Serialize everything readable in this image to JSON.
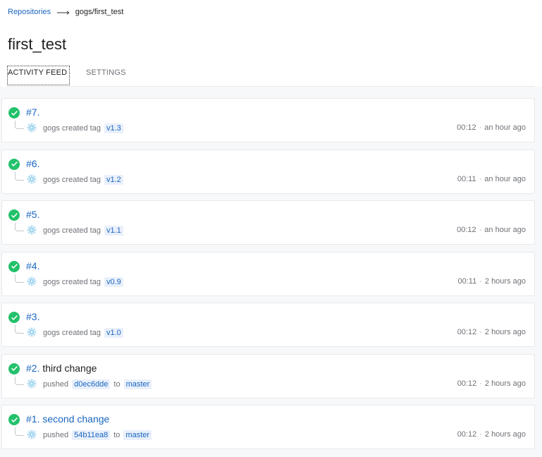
{
  "breadcrumb": {
    "root": "Repositories",
    "current": "gogs/first_test"
  },
  "page_title": "first_test",
  "tabs": [
    {
      "label": "ACTIVITY FEED"
    },
    {
      "label": "SETTINGS"
    }
  ],
  "builds": [
    {
      "number": "#7.",
      "message": "",
      "author": "gogs",
      "action": "created tag",
      "ref": "v1.3",
      "time": "00:12",
      "ago": "an hour ago"
    },
    {
      "number": "#6.",
      "message": "",
      "author": "gogs",
      "action": "created tag",
      "ref": "v1.2",
      "time": "00:11",
      "ago": "an hour ago"
    },
    {
      "number": "#5.",
      "message": "",
      "author": "gogs",
      "action": "created tag",
      "ref": "v1.1",
      "time": "00:12",
      "ago": "an hour ago"
    },
    {
      "number": "#4.",
      "message": "",
      "author": "gogs",
      "action": "created tag",
      "ref": "v0.9",
      "time": "00:11",
      "ago": "2 hours ago"
    },
    {
      "number": "#3.",
      "message": "",
      "author": "gogs",
      "action": "created tag",
      "ref": "v1.0",
      "time": "00:12",
      "ago": "2 hours ago"
    },
    {
      "number": "#2.",
      "message": "third change",
      "author": "",
      "action": "pushed",
      "ref": "d0ec6dde",
      "to": "to",
      "branch": "master",
      "time": "00:12",
      "ago": "2 hours ago"
    },
    {
      "number": "#1.",
      "message": "second change",
      "author": "",
      "action": "pushed",
      "ref": "54b11ea8",
      "to": "to",
      "branch": "master",
      "time": "00:12",
      "ago": "2 hours ago"
    }
  ],
  "colors": {
    "success": "#23c16b",
    "link": "#1a66c0"
  }
}
